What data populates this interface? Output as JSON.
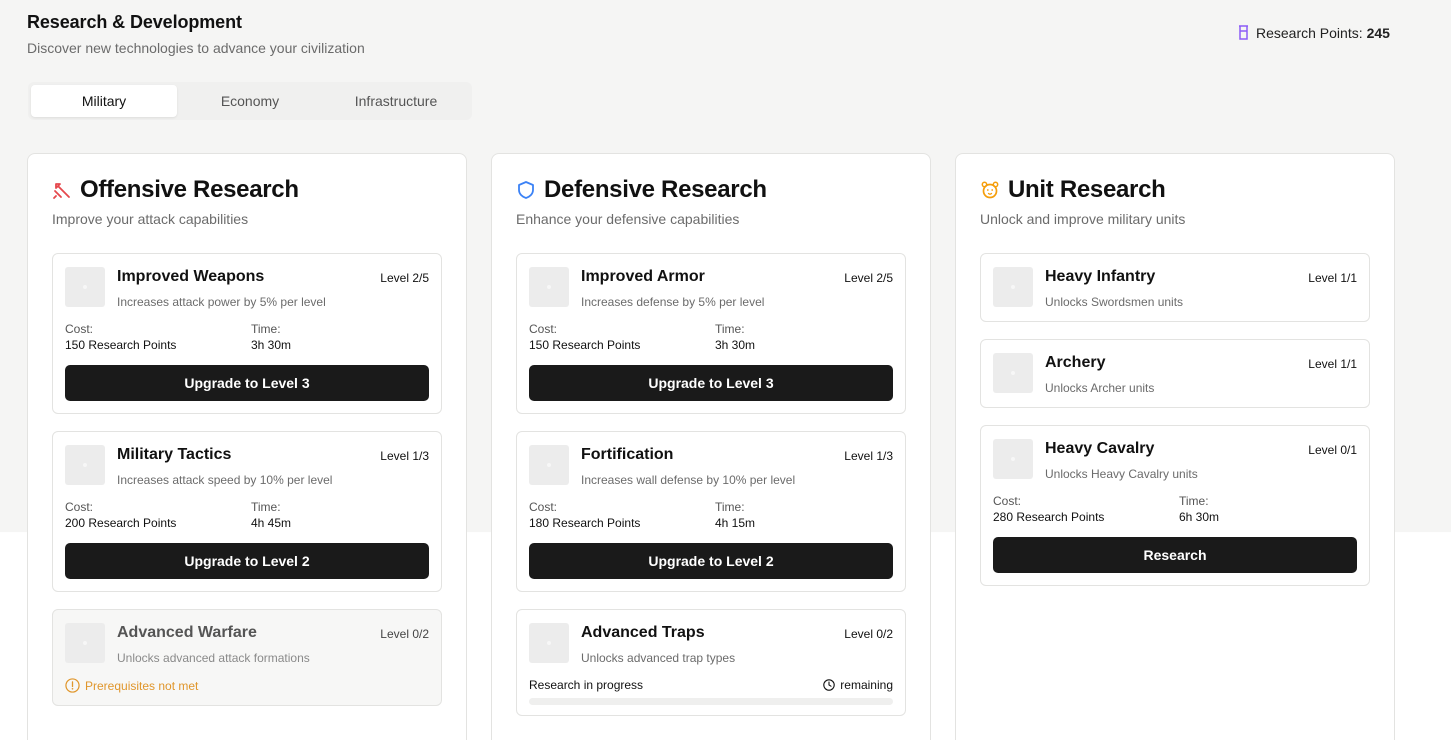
{
  "header": {
    "title": "Research & Development",
    "subtitle": "Discover new technologies to advance your civilization",
    "points_label": "Research Points:",
    "points_value": "245",
    "points_icon": "beaker-icon"
  },
  "tabs": [
    {
      "label": "Military",
      "active": true
    },
    {
      "label": "Economy",
      "active": false
    },
    {
      "label": "Infrastructure",
      "active": false
    }
  ],
  "colors": {
    "accent_red": "#e5484d",
    "accent_blue": "#3b82f6",
    "accent_orange": "#f59e0b",
    "warning": "#e0962b",
    "button": "#1a1a1a"
  },
  "columns": [
    {
      "title": "Offensive Research",
      "subtitle": "Improve your attack capabilities",
      "icon": "sword-icon",
      "cards": [
        {
          "title": "Improved Weapons",
          "desc": "Increases attack power by 5% per level",
          "level": "Level 2/5",
          "cost_label": "Cost:",
          "cost": "150 Research Points",
          "time_label": "Time:",
          "time": "3h 30m",
          "button": "Upgrade to Level 3"
        },
        {
          "title": "Military Tactics",
          "desc": "Increases attack speed by 10% per level",
          "level": "Level 1/3",
          "cost_label": "Cost:",
          "cost": "200 Research Points",
          "time_label": "Time:",
          "time": "4h 45m",
          "button": "Upgrade to Level 2"
        },
        {
          "title": "Advanced Warfare",
          "desc": "Unlocks advanced attack formations",
          "level": "Level 0/2",
          "prereq": "Prerequisites not met"
        }
      ]
    },
    {
      "title": "Defensive Research",
      "subtitle": "Enhance your defensive capabilities",
      "icon": "shield-icon",
      "cards": [
        {
          "title": "Improved Armor",
          "desc": "Increases defense by 5% per level",
          "level": "Level 2/5",
          "cost_label": "Cost:",
          "cost": "150 Research Points",
          "time_label": "Time:",
          "time": "3h 30m",
          "button": "Upgrade to Level 3"
        },
        {
          "title": "Fortification",
          "desc": "Increases wall defense by 10% per level",
          "level": "Level 1/3",
          "cost_label": "Cost:",
          "cost": "180 Research Points",
          "time_label": "Time:",
          "time": "4h 15m",
          "button": "Upgrade to Level 2"
        },
        {
          "title": "Advanced Traps",
          "desc": "Unlocks advanced trap types",
          "level": "Level 0/2",
          "progress_label": "Research in progress",
          "progress_remaining": "remaining",
          "progress_fraction": 0
        }
      ]
    },
    {
      "title": "Unit Research",
      "subtitle": "Unlock and improve military units",
      "icon": "paw-icon",
      "cards": [
        {
          "title": "Heavy Infantry",
          "desc": "Unlocks Swordsmen units",
          "level": "Level 1/1"
        },
        {
          "title": "Archery",
          "desc": "Unlocks Archer units",
          "level": "Level 1/1"
        },
        {
          "title": "Heavy Cavalry",
          "desc": "Unlocks Heavy Cavalry units",
          "level": "Level 0/1",
          "cost_label": "Cost:",
          "cost": "280 Research Points",
          "time_label": "Time:",
          "time": "6h 30m",
          "button": "Research"
        }
      ]
    }
  ]
}
